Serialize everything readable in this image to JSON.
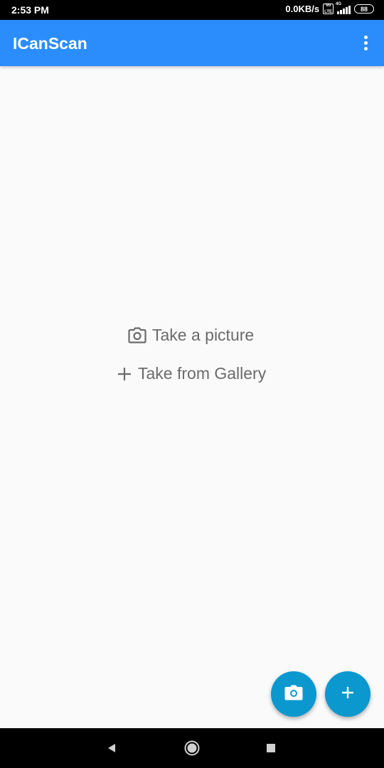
{
  "status_bar": {
    "time": "2:53 PM",
    "net_speed": "0.0KB/s",
    "volte_top": "Vo",
    "volte_bottom": "LTE",
    "network_type": "4G",
    "battery": "88"
  },
  "app_bar": {
    "title": "ICanScan",
    "menu_icon": "more-vert-icon",
    "background": "#2b8dfc"
  },
  "main": {
    "take_picture": {
      "label": "Take a picture",
      "icon": "camera-icon"
    },
    "take_gallery": {
      "label": "Take from Gallery",
      "icon": "plus-icon"
    }
  },
  "fabs": {
    "camera": {
      "icon": "camera-icon",
      "color": "#0a98cf"
    },
    "add": {
      "icon": "plus-icon",
      "color": "#0a98cf"
    }
  },
  "nav_bar": {
    "back": "back-triangle-icon",
    "home": "home-circle-icon",
    "recents": "recents-square-icon"
  }
}
